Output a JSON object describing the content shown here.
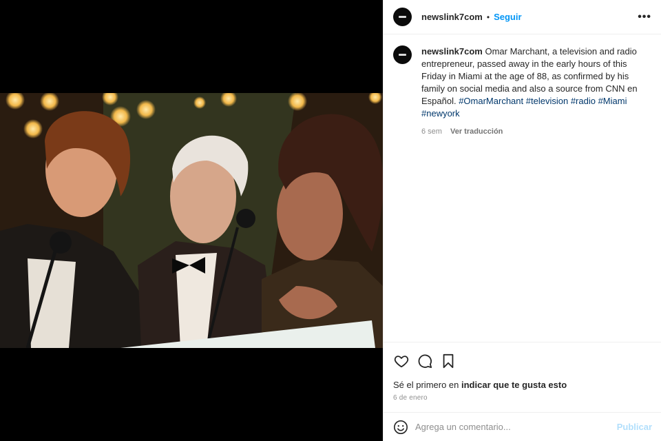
{
  "post": {
    "username": "newslink7com",
    "separator": "•",
    "follow_label": "Seguir",
    "more_label": "•••",
    "caption_text": " Omar Marchant, a television and radio entrepreneur, passed away in the early hours of this Friday in Miami at the age of 88, as confirmed by his family on social media and also a source from CNN en Español. ",
    "hashtags": [
      "#OmarMarchant",
      "#television",
      "#radio",
      "#Miami",
      "#newyork"
    ],
    "time_ago": "6 sem",
    "translate_label": "Ver traducción",
    "likes_prefix": "Sé el primero en ",
    "likes_link": "indicar que te gusta esto",
    "date": "6 de enero",
    "comment_placeholder": "Agrega un comentario...",
    "publish_label": "Publicar"
  },
  "icons": {
    "like": "heart-icon",
    "comment": "comment-icon",
    "save": "bookmark-icon",
    "emoji": "smiley-icon",
    "more": "more-options-icon"
  },
  "colors": {
    "link_blue": "#0095f6",
    "hashtag": "#00376b",
    "publish_disabled": "#b2dffc",
    "muted": "#8e8e8e"
  }
}
